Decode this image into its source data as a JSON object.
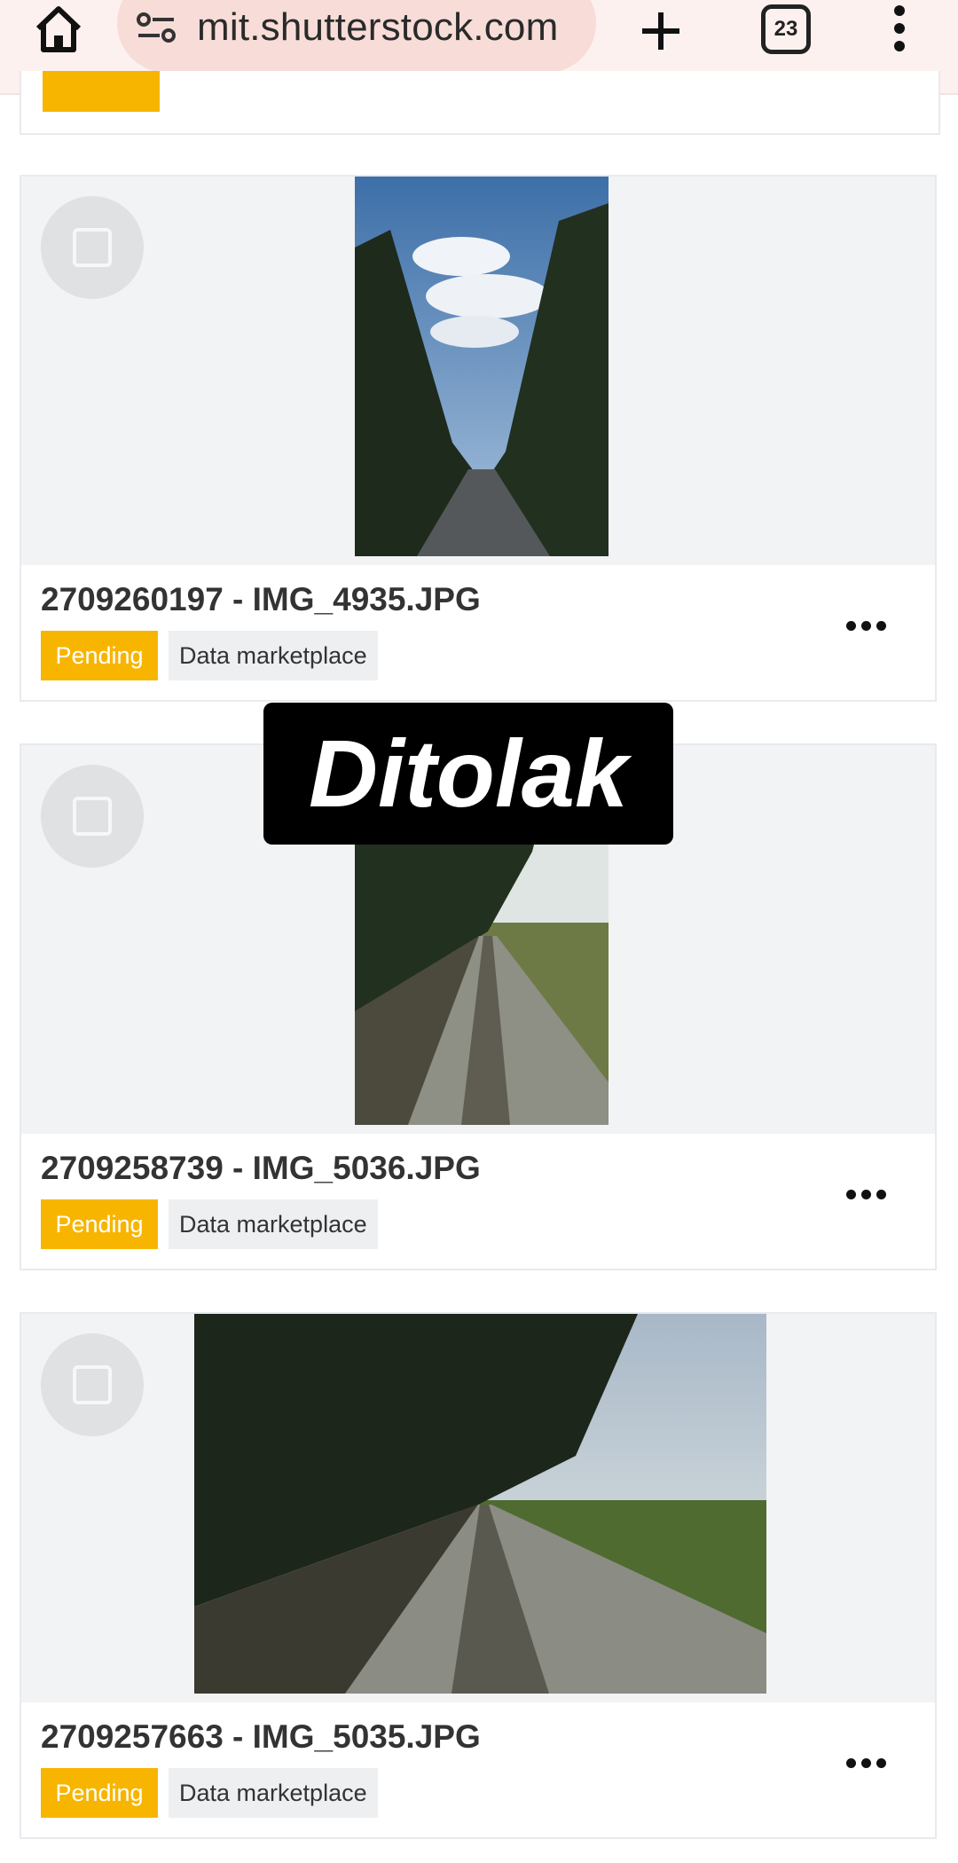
{
  "browser": {
    "url": "mit.shutterstock.com",
    "tab_count": "23"
  },
  "items": [
    {
      "id_name": "2709260197 - IMG_4935.JPG",
      "status": "Pending",
      "tag": "Data marketplace"
    },
    {
      "id_name": "2709258739 - IMG_5036.JPG",
      "status": "Pending",
      "tag": "Data marketplace"
    },
    {
      "id_name": "2709257663 - IMG_5035.JPG",
      "status": "Pending",
      "tag": "Data marketplace"
    }
  ],
  "overlay": {
    "text": "Ditolak"
  },
  "colors": {
    "pending": "#f7b500",
    "topbar": "#fcf1ef"
  }
}
